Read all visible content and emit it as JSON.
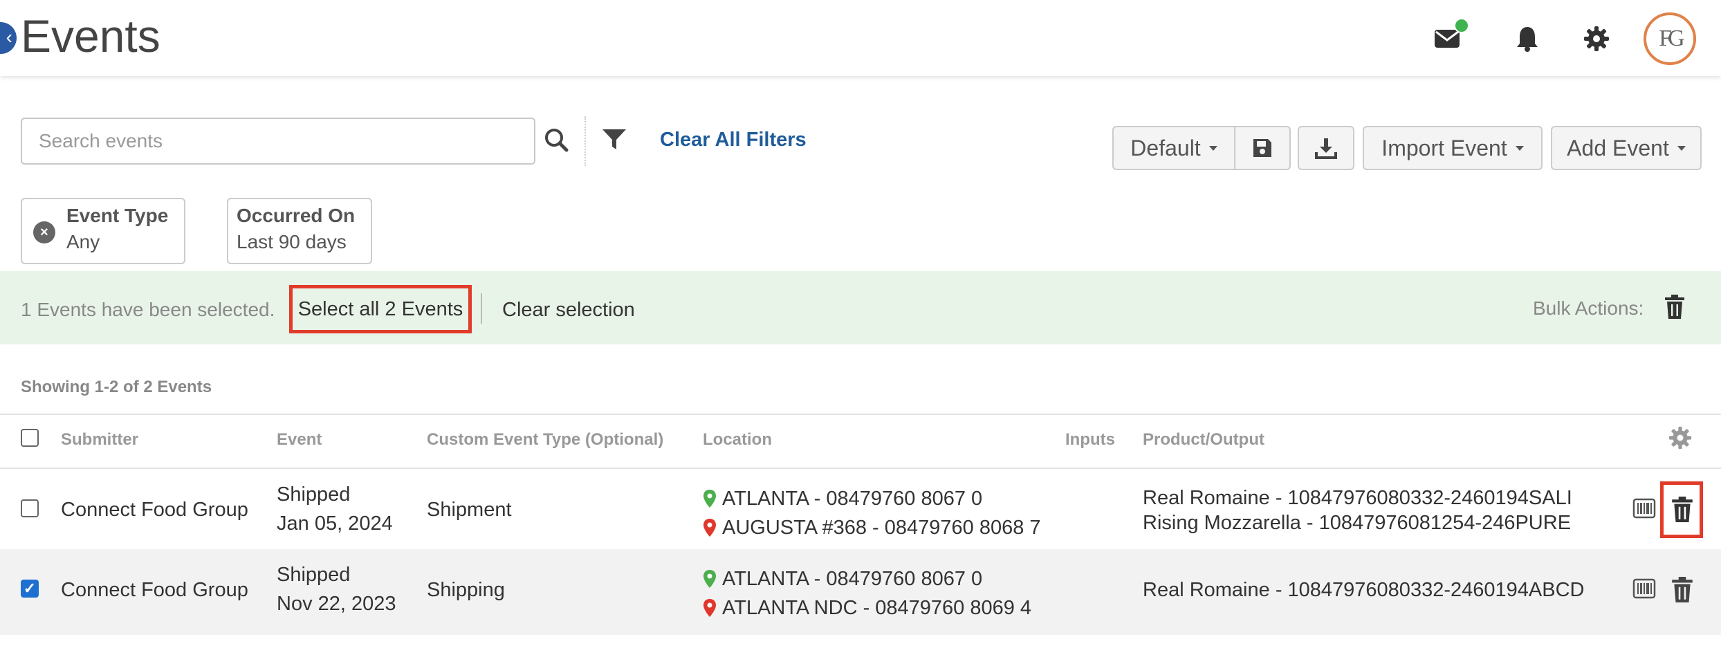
{
  "header": {
    "title": "Events",
    "avatar_initials": "FG"
  },
  "search": {
    "placeholder": "Search events"
  },
  "filters": {
    "clear_all": "Clear All Filters",
    "chips": [
      {
        "title": "Event Type",
        "value": "Any"
      },
      {
        "title": "Occurred On",
        "value": "Last 90 days"
      }
    ]
  },
  "toolbar": {
    "view_label": "Default",
    "import_label": "Import Event",
    "add_label": "Add Event"
  },
  "selection": {
    "message": "1 Events have been selected.",
    "select_all": "Select all 2 Events",
    "clear": "Clear selection",
    "bulk_label": "Bulk Actions:"
  },
  "table": {
    "showing": "Showing 1-2 of 2 Events",
    "columns": [
      "Submitter",
      "Event",
      "Custom Event Type (Optional)",
      "Location",
      "Inputs",
      "Product/Output"
    ],
    "rows": [
      {
        "checked": false,
        "submitter": "Connect Food Group",
        "event": "Shipped",
        "date": "Jan 05, 2024",
        "custom_type": "Shipment",
        "location_from": "ATLANTA - 08479760 8067 0",
        "location_to": "AUGUSTA #368 - 08479760 8068 7",
        "inputs": "",
        "products": [
          "Real Romaine - 10847976080332-2460194SALI",
          "Rising Mozzarella - 10847976081254-246PURE"
        ]
      },
      {
        "checked": true,
        "submitter": "Connect Food Group",
        "event": "Shipped",
        "date": "Nov 22, 2023",
        "custom_type": "Shipping",
        "location_from": "ATLANTA - 08479760 8067 0",
        "location_to": "ATLANTA NDC - 08479760 8069 4",
        "inputs": "",
        "products": [
          "Real Romaine - 10847976080332-2460194ABCD"
        ]
      }
    ]
  },
  "colors": {
    "accent_link": "#1f5c99",
    "highlight_red": "#e23b2a",
    "selection_bg": "#e9f4e9",
    "pin_green": "#4cae4c",
    "pin_red": "#e0372c",
    "notification_dot": "#3fb34f"
  },
  "icons": [
    "back-icon",
    "mail-icon",
    "bell-icon",
    "gear-icon",
    "search-icon",
    "filter-icon",
    "save-icon",
    "download-icon",
    "trash-icon",
    "barcode-icon",
    "map-pin-icon"
  ]
}
